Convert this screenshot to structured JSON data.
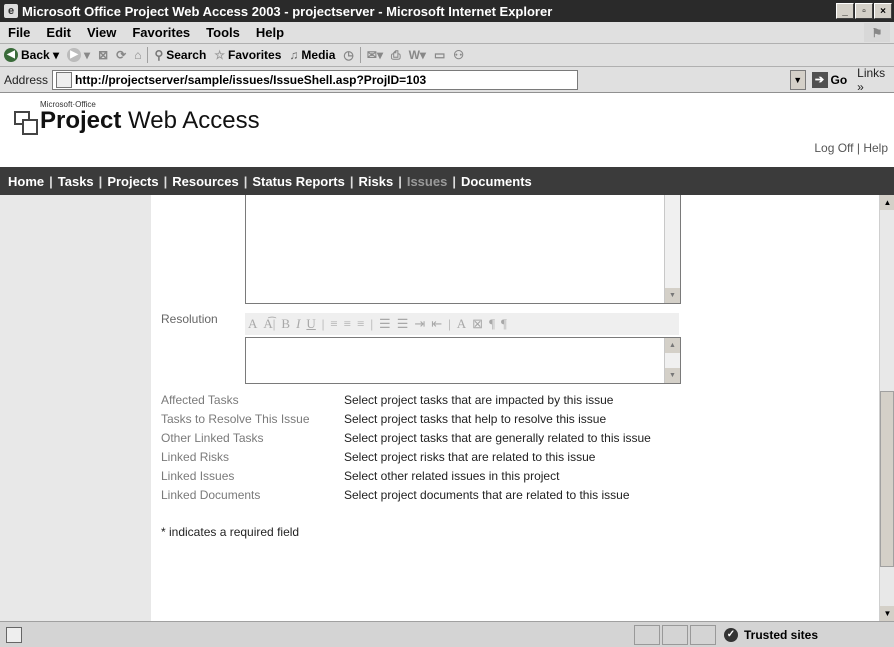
{
  "window": {
    "title": "Microsoft Office Project Web Access 2003 - projectserver - Microsoft Internet Explorer"
  },
  "menu": [
    "File",
    "Edit",
    "View",
    "Favorites",
    "Tools",
    "Help"
  ],
  "toolbar": {
    "back": "Back",
    "search": "Search",
    "favorites": "Favorites",
    "media": "Media"
  },
  "address": {
    "label": "Address",
    "url": "http://projectserver/sample/issues/IssueShell.asp?ProjID=103",
    "go": "Go",
    "links": "Links »"
  },
  "header": {
    "logo_small": "Microsoft·Office",
    "logo_big_bold": "Project",
    "logo_big_rest": " Web Access",
    "logoff": "Log Off",
    "help": "Help",
    "sep": "|"
  },
  "nav": [
    "Home",
    "Tasks",
    "Projects",
    "Resources",
    "Status Reports",
    "Risks",
    "Issues",
    "Documents"
  ],
  "nav_active": "Issues",
  "form": {
    "resolution_label": "Resolution",
    "rt_buttons": [
      "A",
      "A͡|",
      "B",
      "I",
      "U",
      "|",
      "≡",
      "≡",
      "≡",
      "|",
      "☰",
      "☰",
      "⇥",
      "⇤",
      "|",
      "A",
      "⊠",
      "¶",
      "¶"
    ],
    "links": [
      {
        "label": "Affected Tasks",
        "desc": "Select project tasks that are impacted by this issue"
      },
      {
        "label": "Tasks to Resolve This Issue",
        "desc": "Select project tasks that help to resolve this issue"
      },
      {
        "label": "Other Linked Tasks",
        "desc": "Select project tasks that are generally related to this issue"
      },
      {
        "label": "Linked Risks",
        "desc": "Select project risks that are related to this issue"
      },
      {
        "label": "Linked Issues",
        "desc": "Select other related issues in this project"
      },
      {
        "label": "Linked Documents",
        "desc": "Select project documents that are related to this issue"
      }
    ],
    "required_note": "*  indicates a required field"
  },
  "status": {
    "zone": "Trusted sites"
  }
}
